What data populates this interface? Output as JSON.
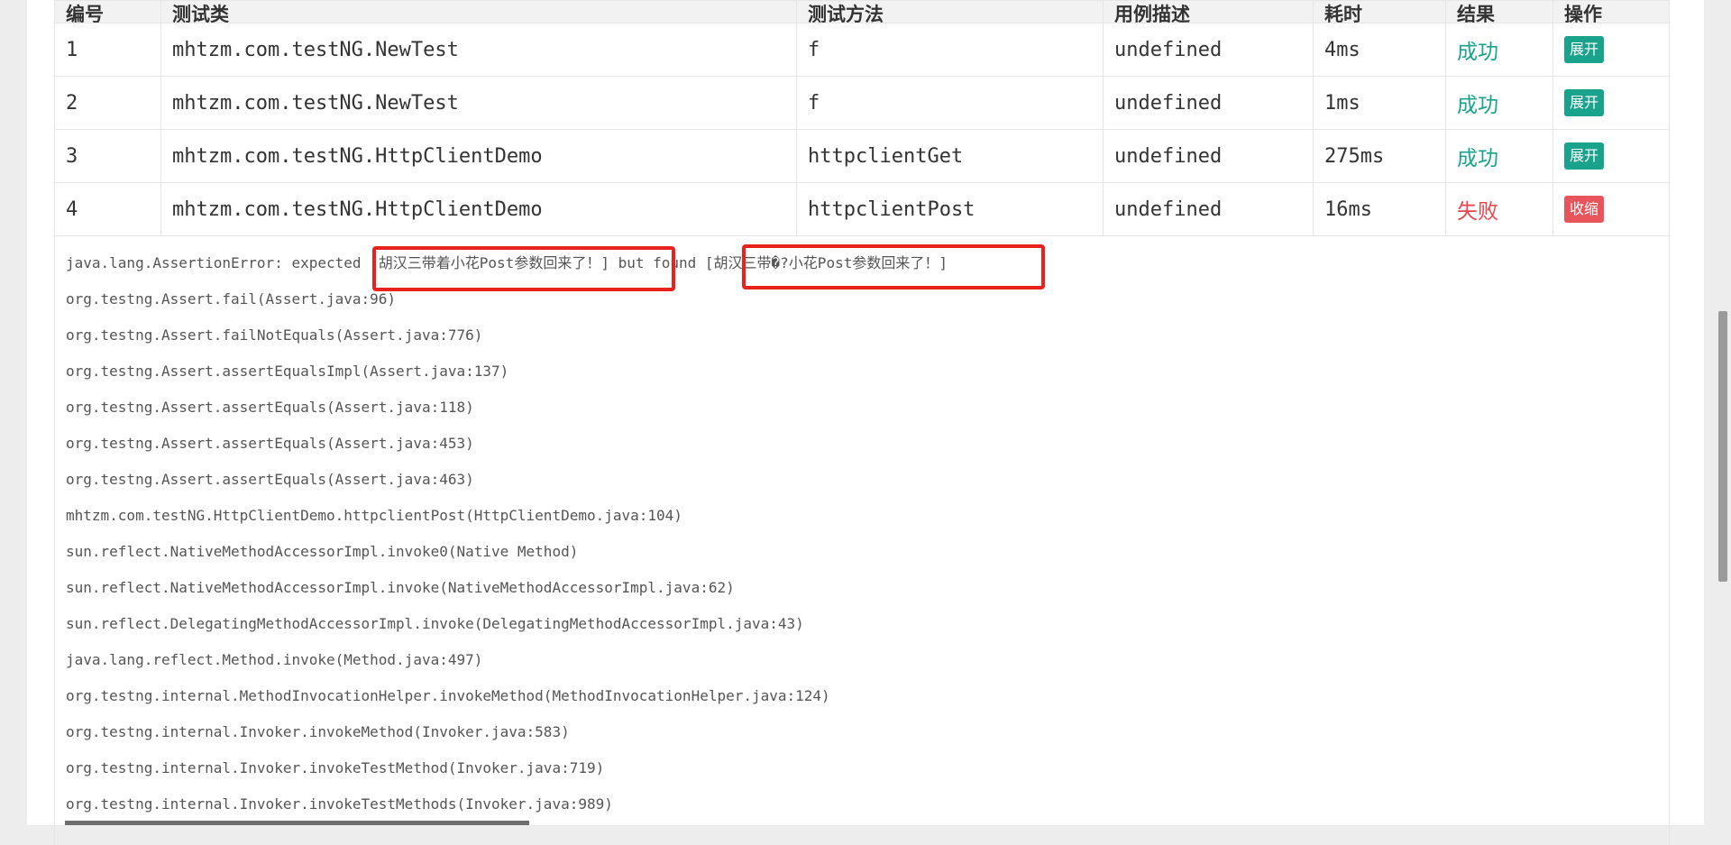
{
  "table": {
    "headers": [
      "编号",
      "测试类",
      "测试方法",
      "用例描述",
      "耗时",
      "结果",
      "操作"
    ],
    "rows": [
      {
        "id": "1",
        "class": "mhtzm.com.testNG.NewTest",
        "method": "f",
        "desc": "undefined",
        "time": "4ms",
        "result": "成功",
        "action": "展开"
      },
      {
        "id": "2",
        "class": "mhtzm.com.testNG.NewTest",
        "method": "f",
        "desc": "undefined",
        "time": "1ms",
        "result": "成功",
        "action": "展开"
      },
      {
        "id": "3",
        "class": "mhtzm.com.testNG.HttpClientDemo",
        "method": "httpclientGet",
        "desc": "undefined",
        "time": "275ms",
        "result": "成功",
        "action": "展开"
      },
      {
        "id": "4",
        "class": "mhtzm.com.testNG.HttpClientDemo",
        "method": "httpclientPost",
        "desc": "undefined",
        "time": "16ms",
        "result": "失败",
        "action": "收缩"
      }
    ]
  },
  "trace": {
    "first_line": "java.lang.AssertionError: expected [胡汉三带着小花Post参数回来了！] but found [胡汉三带�?小花Post参数回来了！]",
    "lines": [
      "org.testng.Assert.fail(Assert.java:96)",
      "org.testng.Assert.failNotEquals(Assert.java:776)",
      "org.testng.Assert.assertEqualsImpl(Assert.java:137)",
      "org.testng.Assert.assertEquals(Assert.java:118)",
      "org.testng.Assert.assertEquals(Assert.java:453)",
      "org.testng.Assert.assertEquals(Assert.java:463)",
      "mhtzm.com.testNG.HttpClientDemo.httpclientPost(HttpClientDemo.java:104)",
      "sun.reflect.NativeMethodAccessorImpl.invoke0(Native Method)",
      "sun.reflect.NativeMethodAccessorImpl.invoke(NativeMethodAccessorImpl.java:62)",
      "sun.reflect.DelegatingMethodAccessorImpl.invoke(DelegatingMethodAccessorImpl.java:43)",
      "java.lang.reflect.Method.invoke(Method.java:497)",
      "org.testng.internal.MethodInvocationHelper.invokeMethod(MethodInvocationHelper.java:124)",
      "org.testng.internal.Invoker.invokeMethod(Invoker.java:583)",
      "org.testng.internal.Invoker.invokeTestMethod(Invoker.java:719)",
      "org.testng.internal.Invoker.invokeTestMethods(Invoker.java:989)"
    ]
  },
  "colors": {
    "success": "#1aa38c",
    "fail": "#e8454c",
    "highlight_box": "#e8231f"
  }
}
